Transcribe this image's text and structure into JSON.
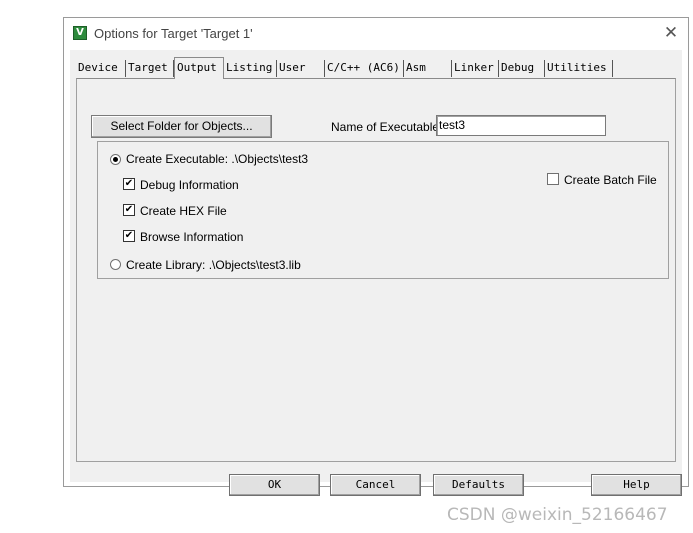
{
  "window": {
    "title": "Options for Target 'Target 1'",
    "close_glyph": "✕"
  },
  "tabs": [
    {
      "label": "Device"
    },
    {
      "label": "Target"
    },
    {
      "label": "Output",
      "active": true
    },
    {
      "label": "Listing"
    },
    {
      "label": "User"
    },
    {
      "label": "C/C++ (AC6)"
    },
    {
      "label": "Asm"
    },
    {
      "label": "Linker"
    },
    {
      "label": "Debug"
    },
    {
      "label": "Utilities"
    }
  ],
  "output": {
    "select_folder_label": "Select Folder for Objects...",
    "name_of_executable_label": "Name of Executable:",
    "name_of_executable_value": "test3",
    "create_executable_label": "Create Executable:  .\\Objects\\test3",
    "create_executable_selected": true,
    "debug_information_label": "Debug Information",
    "debug_information_checked": true,
    "create_hex_label": "Create HEX File",
    "create_hex_checked": true,
    "browse_information_label": "Browse Information",
    "browse_information_checked": true,
    "create_library_label": "Create Library:  .\\Objects\\test3.lib",
    "create_library_selected": false,
    "create_batch_label": "Create Batch File",
    "create_batch_checked": false
  },
  "footer": {
    "ok_label": "OK",
    "cancel_label": "Cancel",
    "defaults_label": "Defaults",
    "help_label": "Help"
  },
  "watermark": "CSDN @weixin_52166467",
  "colors": {
    "dialog_bg": "#f0f0f0",
    "app_icon": "#2e8b3d"
  }
}
